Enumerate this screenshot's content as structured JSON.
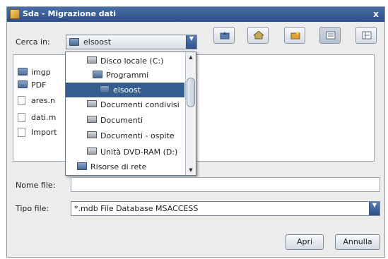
{
  "window": {
    "title": "Sda - Migrazione dati",
    "close_label": "x"
  },
  "lookin": {
    "label": "Cerca in:",
    "selected": "elsoost",
    "icons": {
      "folder_up": "folder-up-icon",
      "home": "home-icon",
      "new_folder": "new-folder-icon",
      "list_view": "list-view-icon",
      "details_view": "details-view-icon"
    }
  },
  "files": [
    {
      "name": "imgp",
      "icon": "folder-icon"
    },
    {
      "name": "PDF",
      "icon": "folder-icon"
    },
    {
      "name": "ares.n",
      "icon": "document-icon"
    },
    {
      "name": "dati.m",
      "icon": "document-icon"
    },
    {
      "name": "Import",
      "icon": "document-icon"
    }
  ],
  "dropdown": {
    "items": [
      {
        "label": "Disco locale (C:)",
        "icon": "drive-icon"
      },
      {
        "label": "Programmi",
        "icon": "folder-icon"
      },
      {
        "label": "elsoost",
        "icon": "folder-icon"
      },
      {
        "label": "Documenti condivisi",
        "icon": "drive-icon"
      },
      {
        "label": "Documenti",
        "icon": "drive-icon"
      },
      {
        "label": "Documenti - ospite",
        "icon": "drive-icon"
      },
      {
        "label": "Unità DVD-RAM (D:)",
        "icon": "drive-icon"
      },
      {
        "label": "Risorse di rete",
        "icon": "network-icon"
      }
    ],
    "selected_index": 2
  },
  "filename": {
    "label": "Nome file:",
    "value": ""
  },
  "filetype": {
    "label": "Tipo file:",
    "selected": "*.mdb File Database MSACCESS"
  },
  "buttons": {
    "open": "Apri",
    "cancel": "Annulla"
  }
}
